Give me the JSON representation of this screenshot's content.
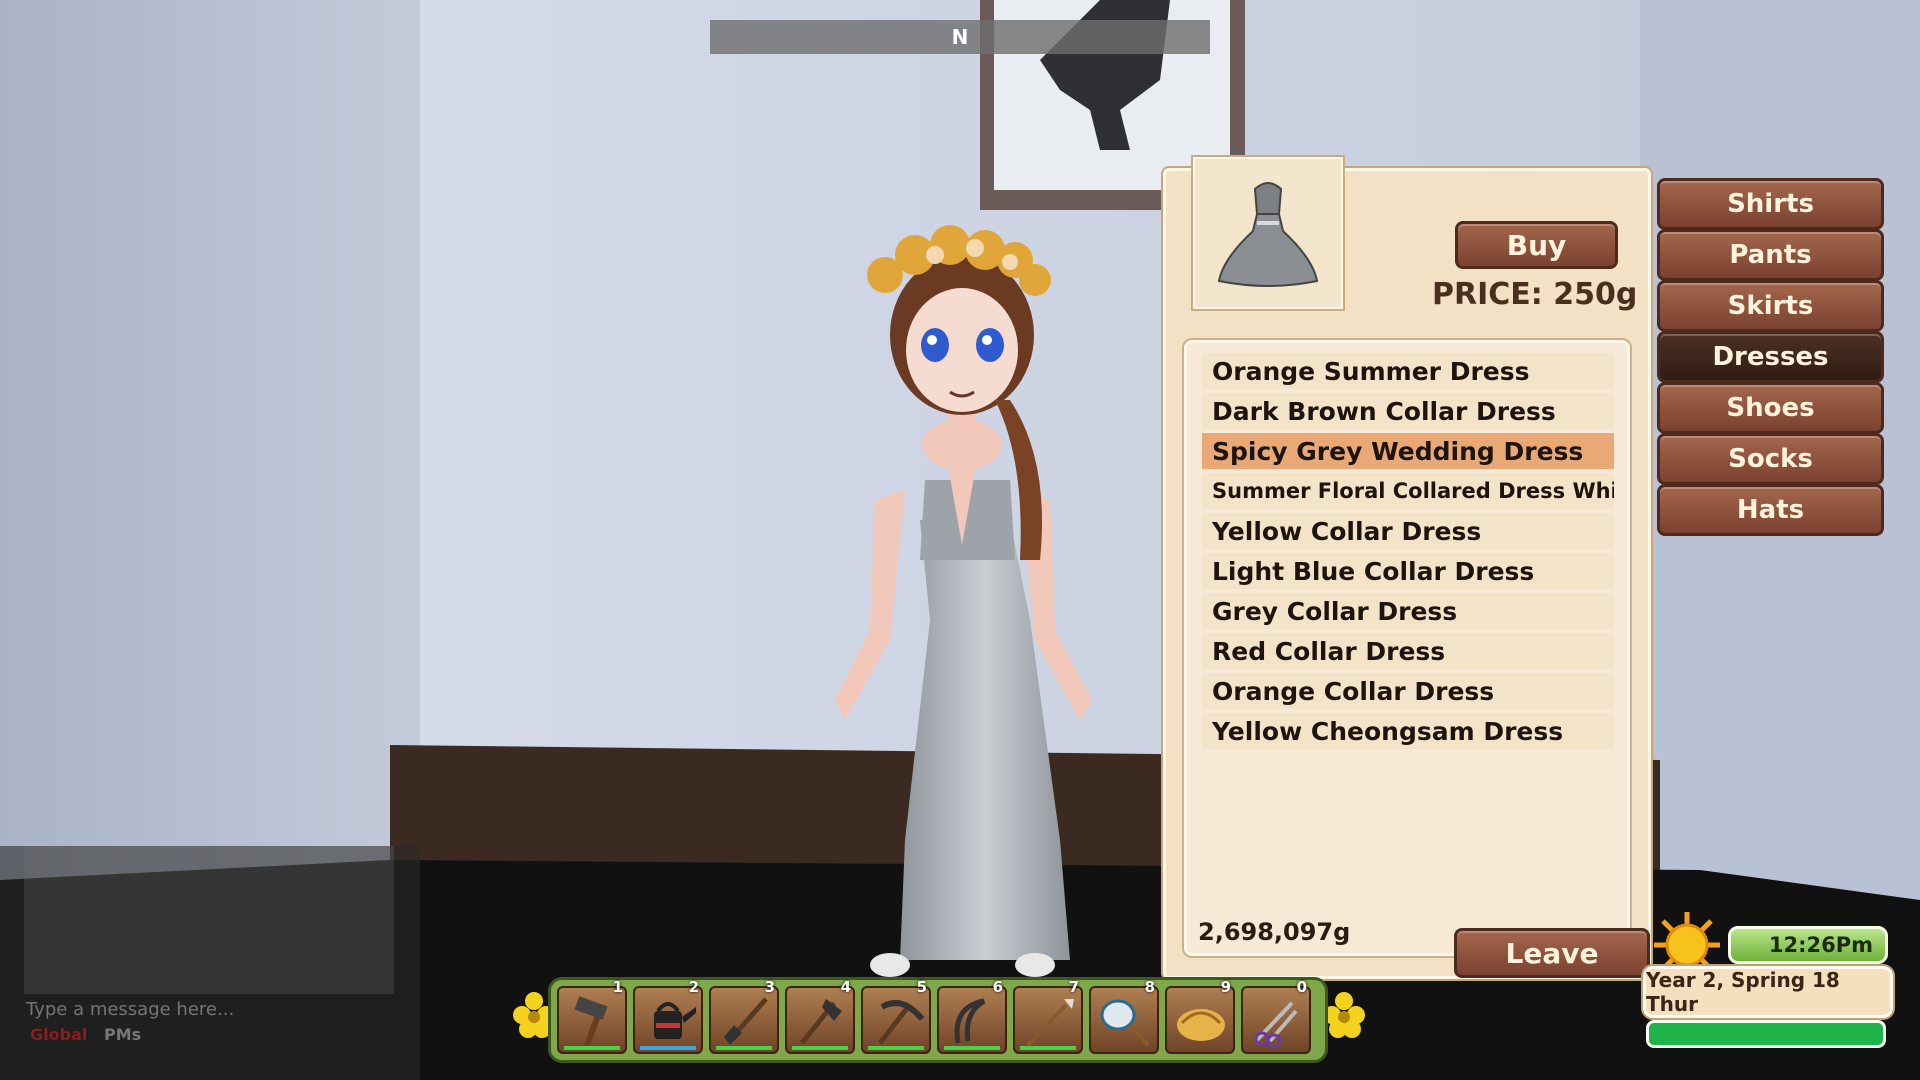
{
  "compass": {
    "heading": "N"
  },
  "shop": {
    "buy_label": "Buy",
    "price_label": "PRICE: 250g",
    "money": "2,698,097g",
    "leave_label": "Leave",
    "preview_icon": "dress-icon",
    "items": [
      {
        "label": "Orange Summer Dress"
      },
      {
        "label": "Dark Brown Collar Dress"
      },
      {
        "label": "Spicy Grey Wedding Dress",
        "selected": true
      },
      {
        "label": "Summer Floral Collared Dress White"
      },
      {
        "label": "Yellow Collar Dress"
      },
      {
        "label": "Light Blue Collar Dress"
      },
      {
        "label": "Grey Collar Dress"
      },
      {
        "label": "Red Collar Dress"
      },
      {
        "label": "Orange Collar Dress"
      },
      {
        "label": "Yellow Cheongsam Dress"
      }
    ]
  },
  "categories": [
    {
      "label": "Shirts"
    },
    {
      "label": "Pants"
    },
    {
      "label": "Skirts"
    },
    {
      "label": "Dresses",
      "active": true
    },
    {
      "label": "Shoes"
    },
    {
      "label": "Socks"
    },
    {
      "label": "Hats"
    }
  ],
  "hotbar": {
    "slots": [
      {
        "key": "1",
        "icon": "hammer-icon"
      },
      {
        "key": "2",
        "icon": "watering-can-icon"
      },
      {
        "key": "3",
        "icon": "shovel-icon"
      },
      {
        "key": "4",
        "icon": "axe-icon"
      },
      {
        "key": "5",
        "icon": "pickaxe-icon"
      },
      {
        "key": "6",
        "icon": "sickle-icon"
      },
      {
        "key": "7",
        "icon": "spear-icon"
      },
      {
        "key": "8",
        "icon": "bug-net-icon"
      },
      {
        "key": "9",
        "icon": "brush-icon"
      },
      {
        "key": "0",
        "icon": "shears-icon"
      }
    ]
  },
  "status": {
    "time": "12:26Pm",
    "date": "Year 2, Spring 18 Thur",
    "weather_icon": "sun-icon"
  },
  "chat": {
    "placeholder": "Type a message here...",
    "tab_global": "Global",
    "tab_pms": "PMs"
  },
  "colors": {
    "panel": "#f2e1c4",
    "selected_row": "#e8a977",
    "button": "#8a5038",
    "active_button": "#3a2419"
  }
}
